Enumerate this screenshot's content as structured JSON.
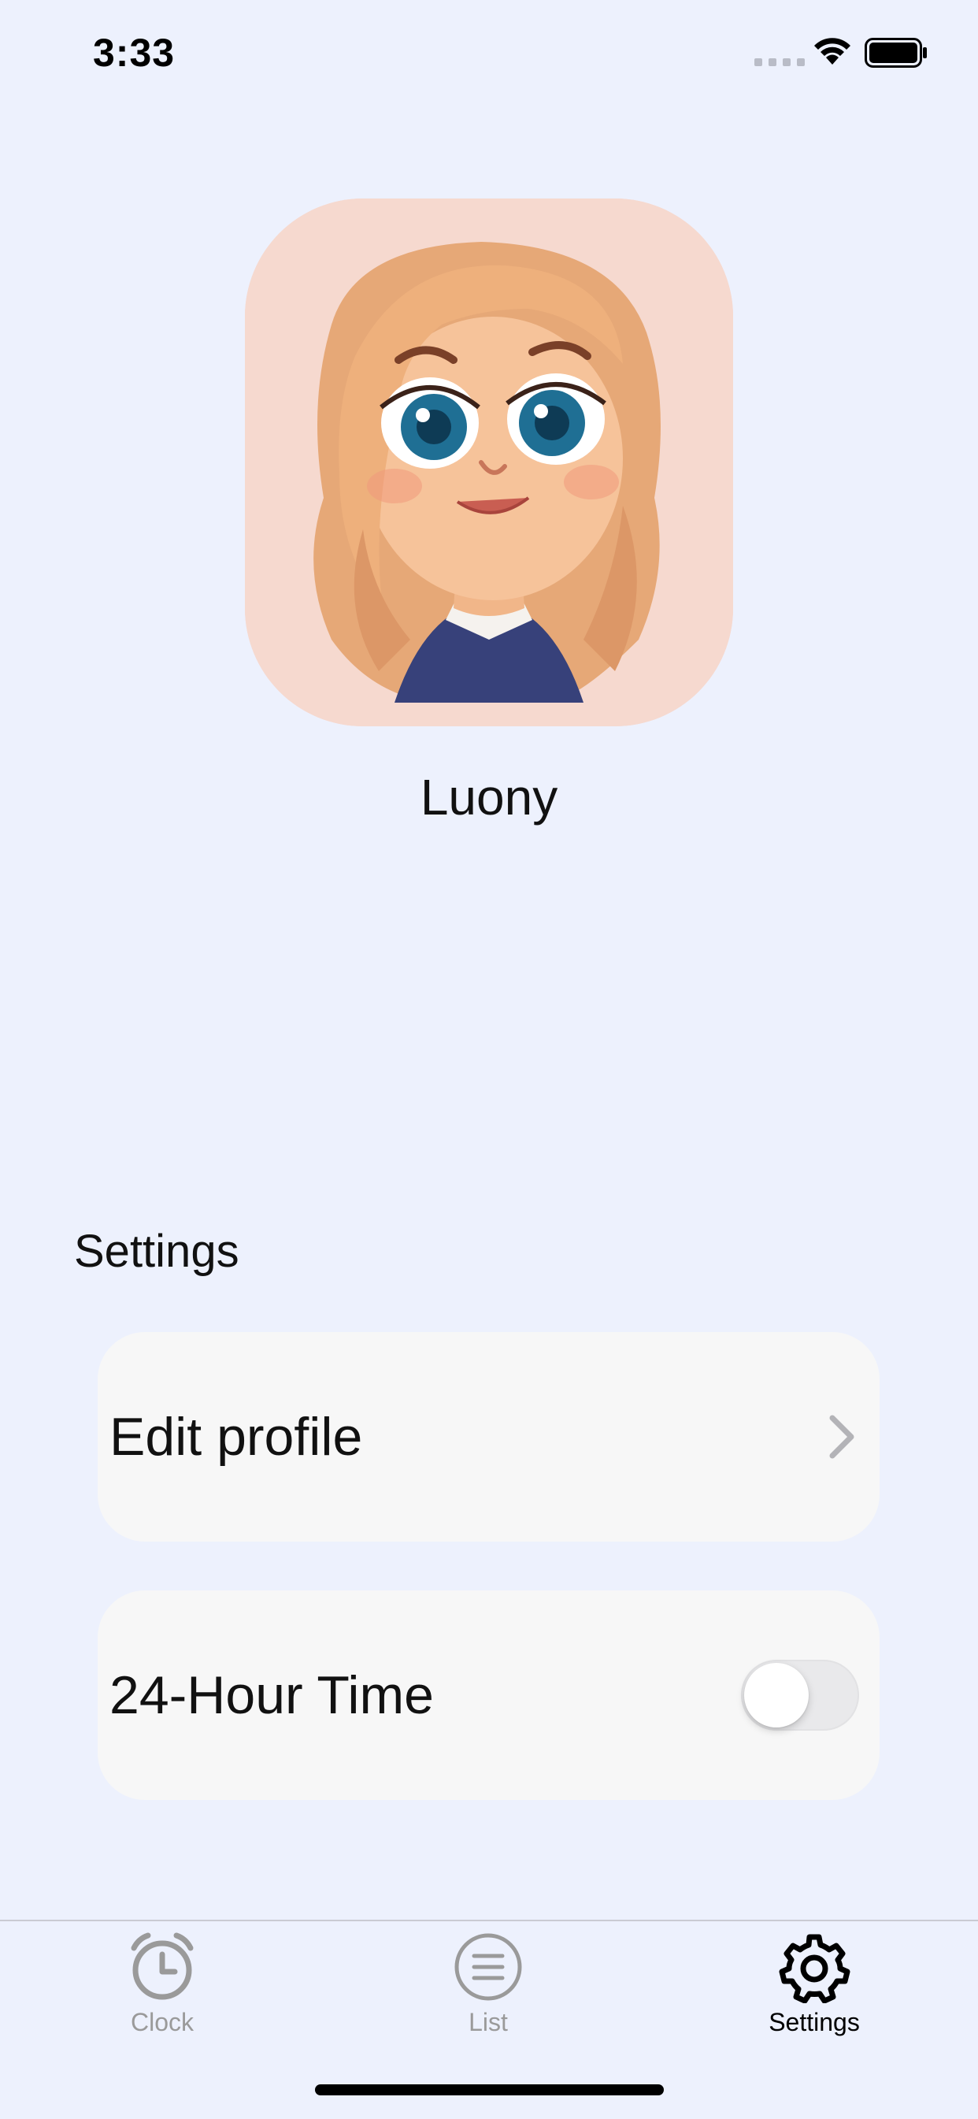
{
  "status_bar": {
    "time": "3:33"
  },
  "profile": {
    "name": "Luony"
  },
  "settings": {
    "title": "Settings",
    "edit_profile_label": "Edit profile",
    "time_format_label": "24-Hour Time",
    "time_format_enabled": false
  },
  "tab_bar": {
    "tabs": [
      {
        "label": "Clock",
        "icon": "alarm-clock-icon",
        "active": false
      },
      {
        "label": "List",
        "icon": "list-icon",
        "active": false
      },
      {
        "label": "Settings",
        "icon": "gear-icon",
        "active": true
      }
    ]
  },
  "colors": {
    "background": "#EDF1FD",
    "card": "#F7F7F7",
    "inactive_tab": "#9a9a9a",
    "active_tab": "#000000",
    "toggle_off": "#E9E9EB"
  }
}
